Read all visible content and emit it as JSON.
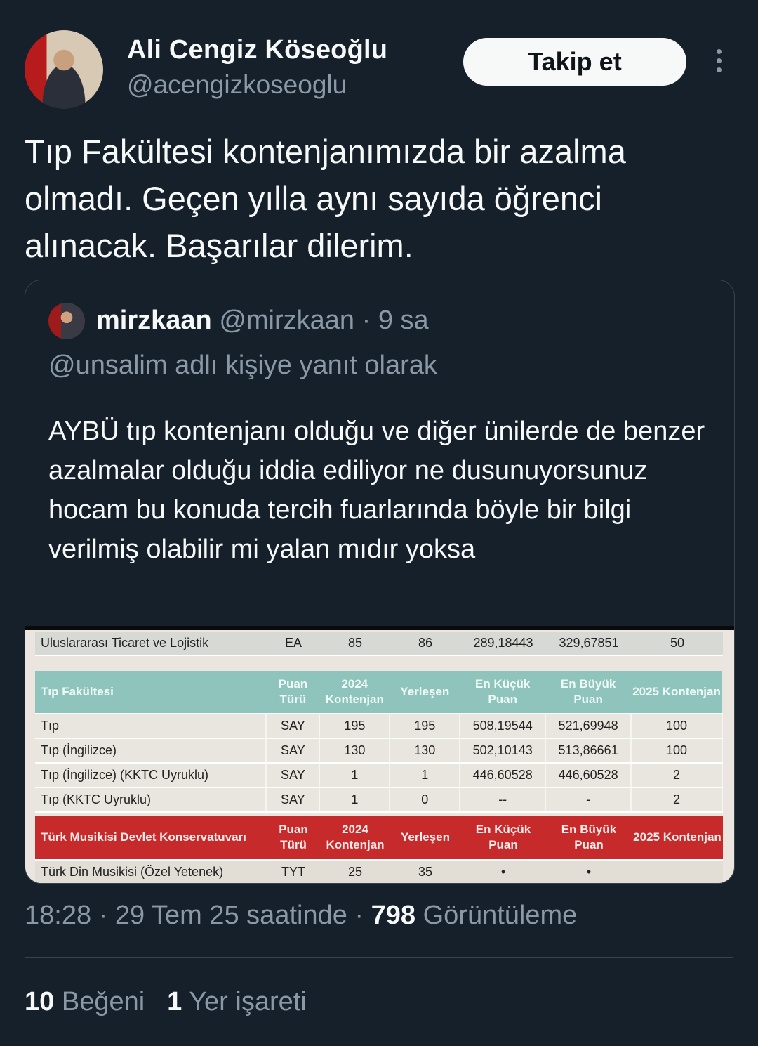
{
  "author": {
    "name": "Ali Cengiz Köseoğlu",
    "handle": "@acengizkoseoglu",
    "follow_label": "Takip et"
  },
  "tweet": {
    "text": "Tıp Fakültesi kontenjanımızda bir azalma olmadı. Geçen yılla aynı sayıda öğrenci alınacak. Başarılar dilerim."
  },
  "quoted": {
    "name": "mirzkaan",
    "handle": "@mirzkaan",
    "separator": "·",
    "time": "9 sa",
    "reply_to": "@unsalim adlı kişiye yanıt olarak",
    "text": "AYBÜ tıp kontenjanı olduğu ve diğer ünilerde de benzer azalmalar olduğu iddia ediliyor ne dusunuyorsunuz hocam bu konuda tercih fuarlarında böyle bir bilgi verilmiş olabilir mi yalan mıdır yoksa",
    "image_table": {
      "top_row": [
        "Uluslararası Ticaret ve Lojistik",
        "EA",
        "85",
        "86",
        "289,18443",
        "329,67851",
        "50"
      ],
      "green_header": [
        "Tıp Fakültesi",
        "Puan Türü",
        "2024 Kontenjan",
        "Yerleşen",
        "En Küçük Puan",
        "En Büyük Puan",
        "2025 Kontenjan"
      ],
      "rows": [
        [
          "Tıp",
          "SAY",
          "195",
          "195",
          "508,19544",
          "521,69948",
          "100"
        ],
        [
          "Tıp (İngilizce)",
          "SAY",
          "130",
          "130",
          "502,10143",
          "513,86661",
          "100"
        ],
        [
          "Tıp (İngilizce) (KKTC Uyruklu)",
          "SAY",
          "1",
          "1",
          "446,60528",
          "446,60528",
          "2"
        ],
        [
          "Tıp (KKTC Uyruklu)",
          "SAY",
          "1",
          "0",
          "--",
          "-",
          "2"
        ]
      ],
      "red_header": [
        "Türk Musikisi Devlet Konservatuvarı",
        "Puan Türü",
        "2024 Kontenjan",
        "Yerleşen",
        "En Küçük Puan",
        "En Büyük Puan",
        "2025 Kontenjan"
      ],
      "bottom_row": [
        "Türk Din Musikisi (Özel Yetenek)",
        "TYT",
        "25",
        "35",
        "•",
        "•",
        ""
      ]
    }
  },
  "meta": {
    "time": "18:28",
    "date": "29 Tem 25 saatinde",
    "separator": "·",
    "views_count": "798",
    "views_label": "Görüntüleme"
  },
  "stats": {
    "likes_count": "10",
    "likes_label": "Beğeni",
    "bookmarks_count": "1",
    "bookmarks_label": "Yer işareti"
  },
  "colors": {
    "background": "#15202b",
    "text": "#f7f9f9",
    "muted": "#8b98a5",
    "border": "#38444d",
    "table_green": "#8fc4bd",
    "table_red": "#c62a2a"
  }
}
